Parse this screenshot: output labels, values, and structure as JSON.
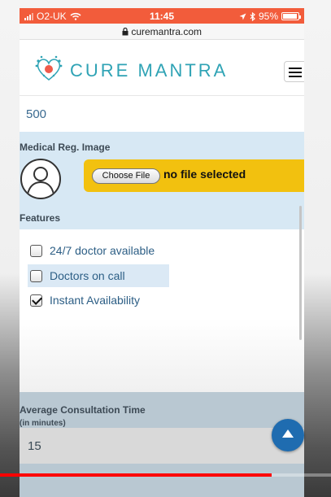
{
  "status_bar": {
    "carrier": "O2-UK",
    "time": "11:45",
    "battery": "95%"
  },
  "browser": {
    "url": "curemantra.com"
  },
  "header": {
    "brand": "CURE MANTRA",
    "logo_icon": "heart-logo-icon",
    "menu_icon": "hamburger-icon"
  },
  "form": {
    "top_value": "500",
    "medical_reg_image": {
      "label": "Medical Reg. Image",
      "choose_button": "Choose File",
      "file_status": "no file selected"
    },
    "features": {
      "label": "Features",
      "items": [
        {
          "label": "24/7 doctor available",
          "checked": false
        },
        {
          "label": "Doctors on call",
          "checked": false
        },
        {
          "label": "Instant Availability",
          "checked": true
        }
      ]
    },
    "consultation_time": {
      "label": "Average Consultation Time",
      "sublabel": "(in minutes)",
      "value": "15"
    }
  },
  "colors": {
    "status_bar": "#f25c3b",
    "brand": "#2fa3b5",
    "section_bg": "#d7e8f4",
    "file_area": "#f2c10f",
    "scroll_button": "#1f6cb0",
    "progress": "#ff0000"
  },
  "video_progress": 0.82
}
